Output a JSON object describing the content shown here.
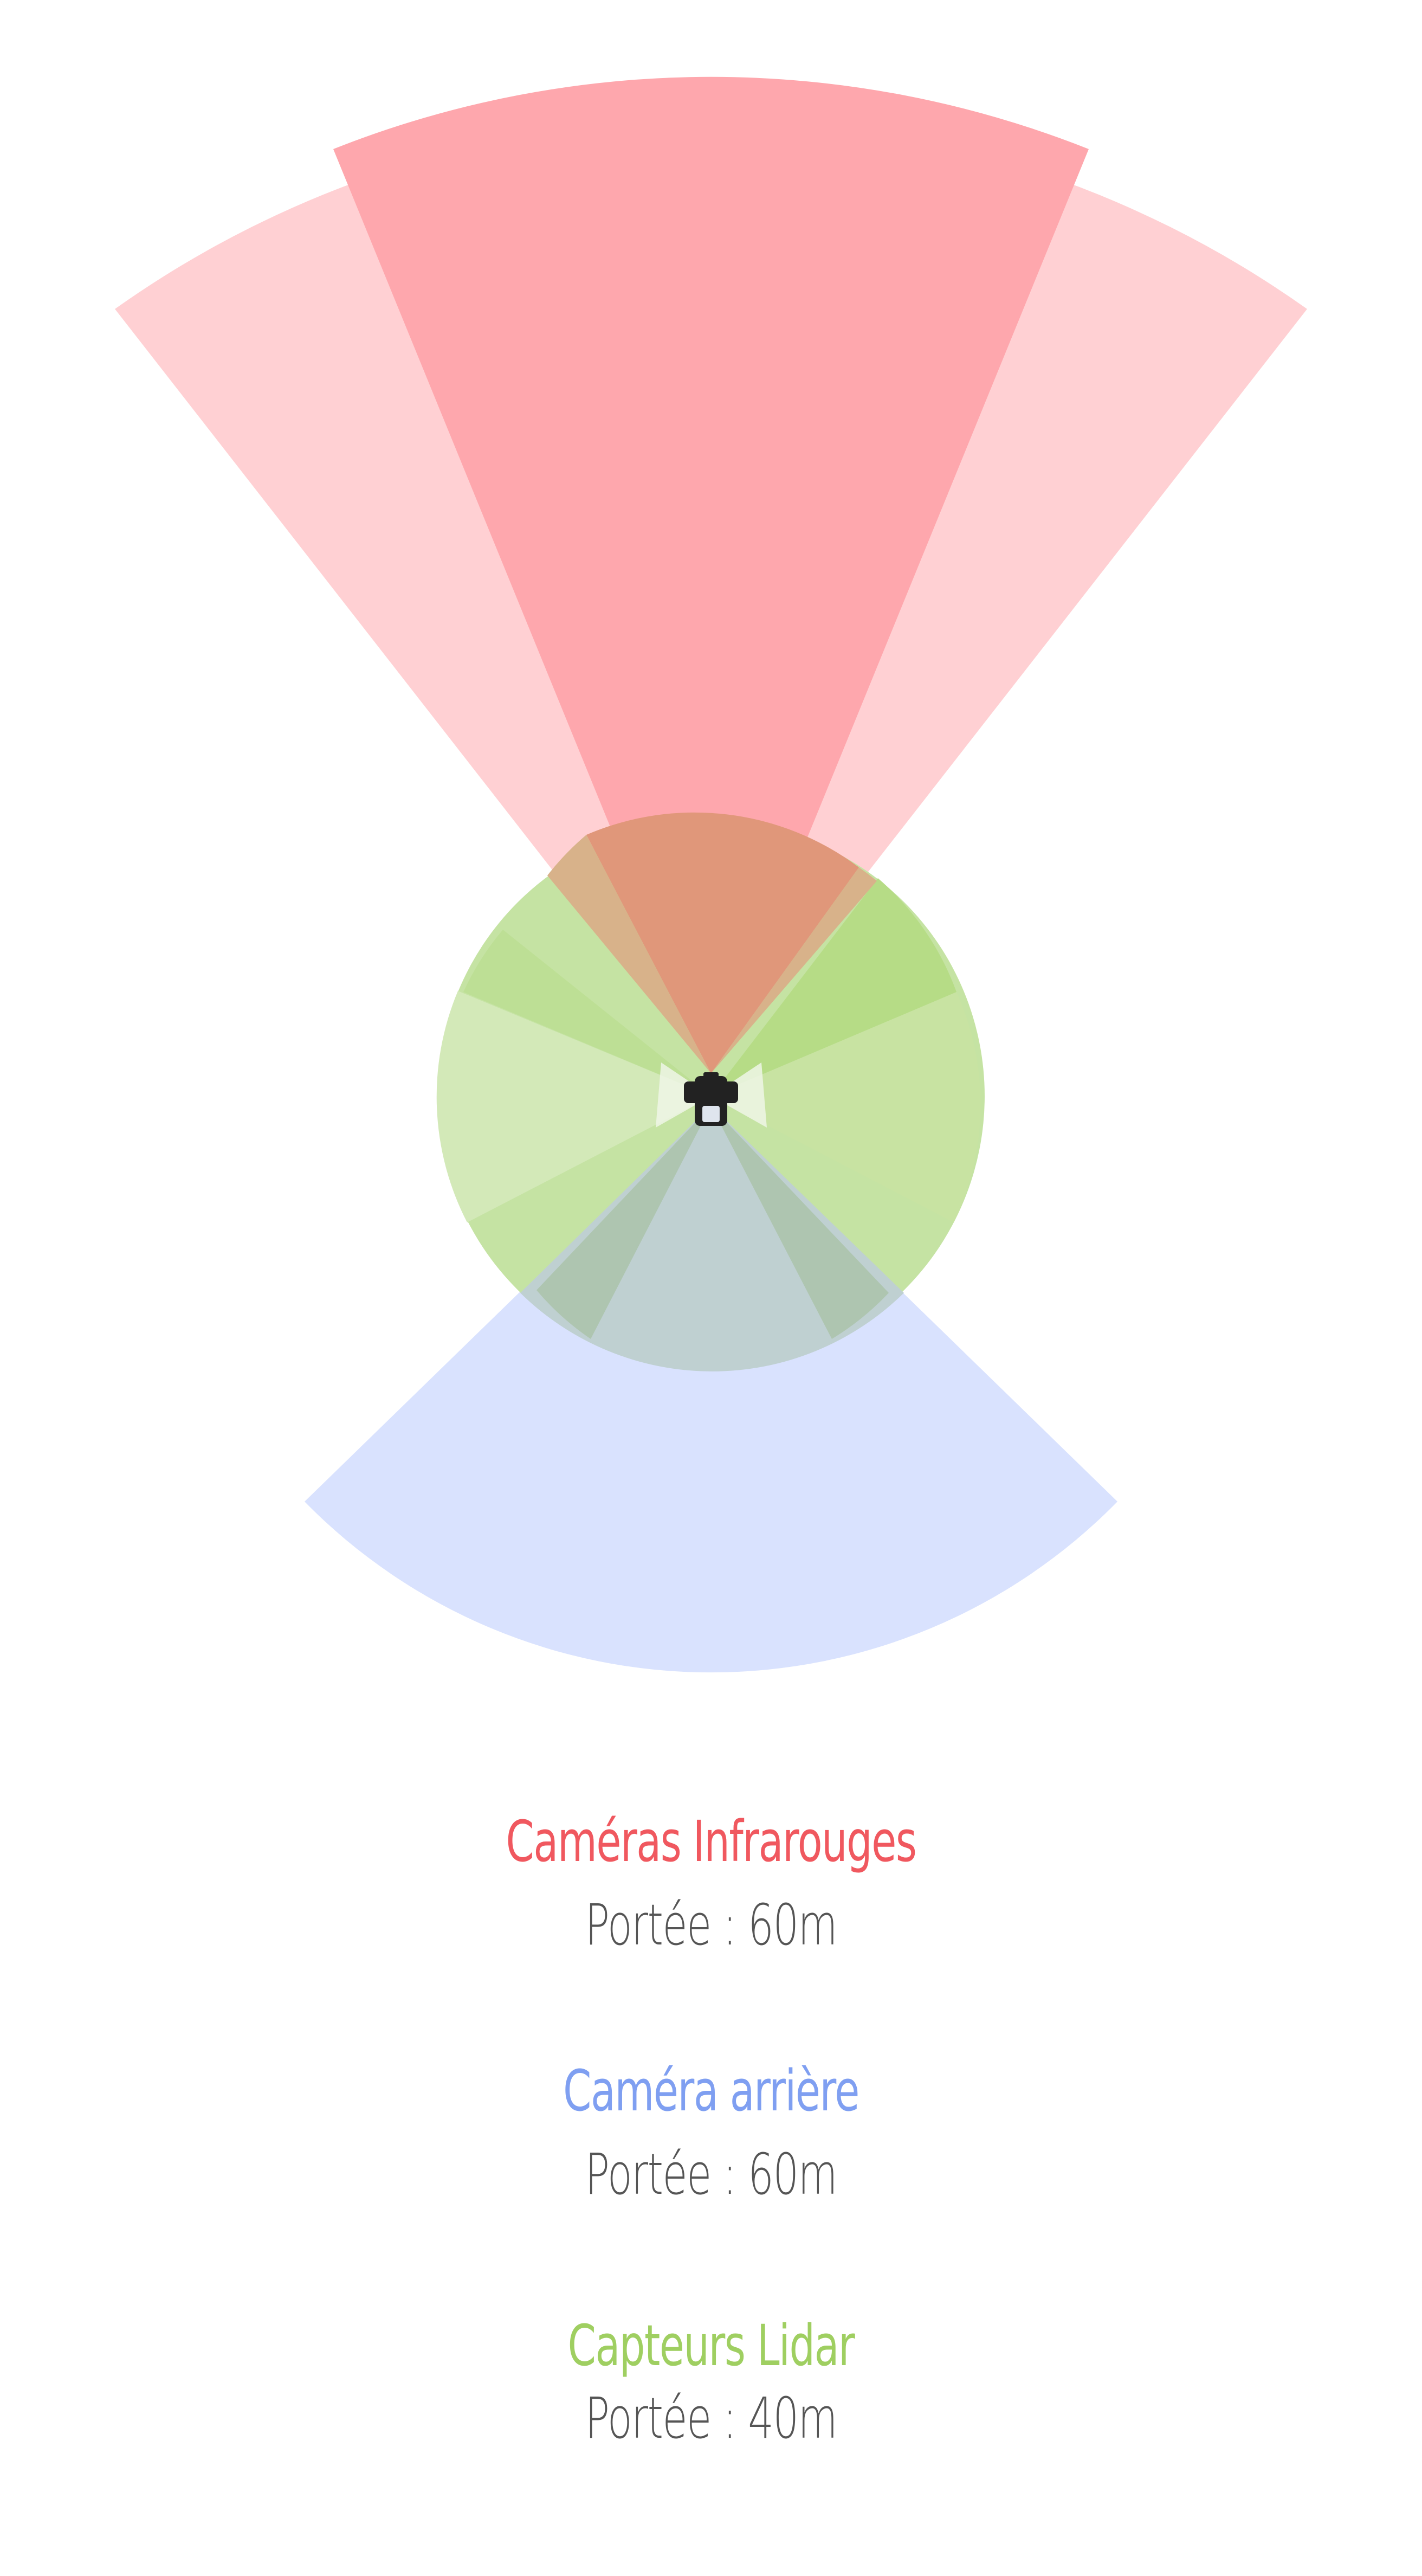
{
  "sensors": [
    {
      "id": "infrared",
      "title": "Caméras Infrarouges",
      "range_text": "Portée : 60m",
      "color": "#f0585f"
    },
    {
      "id": "rear",
      "title": "Caméra arrière",
      "range_text": "Portée : 60m",
      "color": "#7f9ff1"
    },
    {
      "id": "lidar",
      "title": "Capteurs Lidar",
      "range_text": "Portée : 40m",
      "color": "#9fcf61"
    }
  ],
  "colors": {
    "infrared_wide": "#ffd0d3",
    "infrared_center": "#fea7ad",
    "rear_cone": "#d9e2fe",
    "lidar_fill": "#c5e3a3",
    "lidar_light": "#d3e9b8",
    "overlap": "#e0977a",
    "car_body": "#222222"
  },
  "icons": {
    "vehicle": "car-top-view-icon"
  }
}
